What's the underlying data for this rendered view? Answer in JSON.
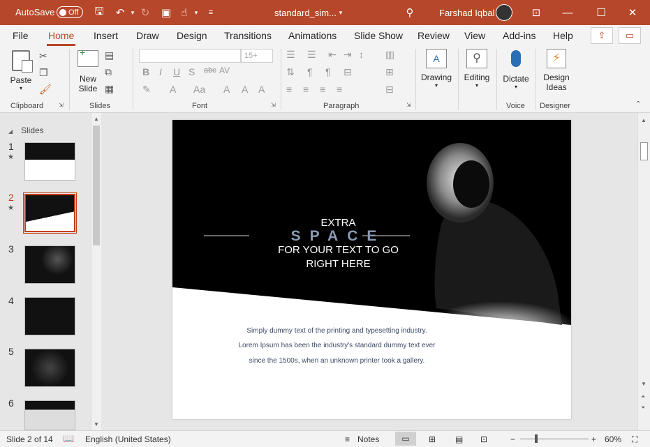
{
  "titlebar": {
    "autosave_label": "AutoSave",
    "toggle_state": "Off",
    "doc_title": "standard_sim...",
    "user_name": "Farshad Iqbal"
  },
  "tabs": [
    "File",
    "Home",
    "Insert",
    "Draw",
    "Design",
    "Transitions",
    "Animations",
    "Slide Show",
    "Review",
    "View",
    "Add-ins",
    "Help"
  ],
  "ribbon": {
    "paste": "Paste",
    "new_slide_1": "New",
    "new_slide_2": "Slide",
    "font_size_placeholder": "15+",
    "drawing": "Drawing",
    "editing": "Editing",
    "dictate": "Dictate",
    "design_ideas_1": "Design",
    "design_ideas_2": "Ideas",
    "groups": {
      "clipboard": "Clipboard",
      "slides": "Slides",
      "font": "Font",
      "paragraph": "Paragraph",
      "voice": "Voice",
      "designer": "Designer"
    }
  },
  "slides_pane": {
    "label": "Slides",
    "numbers": [
      "1",
      "2",
      "3",
      "4",
      "5",
      "6"
    ]
  },
  "slide": {
    "line1": "EXTRA",
    "line2": "SPACE",
    "line3": "FOR YOUR TEXT TO GO",
    "line4": "RIGHT HERE",
    "body1": "Simply dummy text of the printing and typesetting industry.",
    "body2": "Lorem Ipsum has been the industry's standard dummy text ever",
    "body3": "since the 1500s, when an unknown printer took a gallery."
  },
  "status": {
    "slide_info": "Slide 2 of 14",
    "language": "English (United States)",
    "notes": "Notes",
    "zoom": "60%"
  },
  "colors": {
    "accent": "#b7472a",
    "selection": "#c43e1c"
  }
}
